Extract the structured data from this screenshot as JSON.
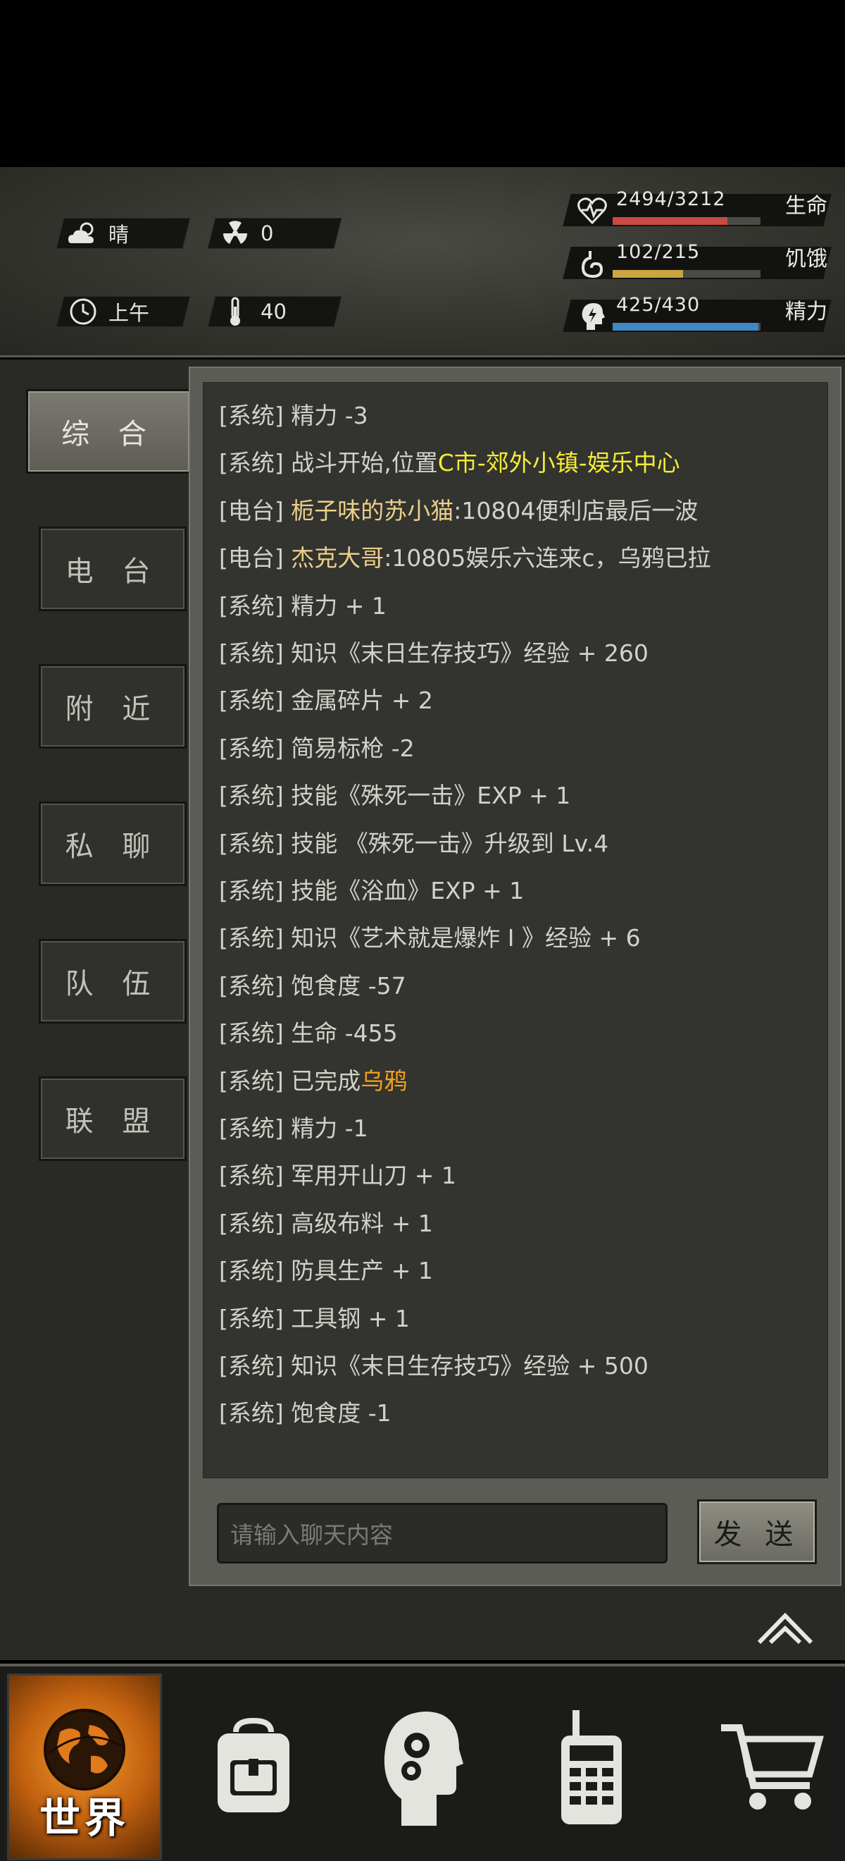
{
  "status": {
    "weather": "晴",
    "radiation": "0",
    "time_of_day": "上午",
    "temperature": "40",
    "health": {
      "value": "2494/3212",
      "label": "生命",
      "fraction": 0.776,
      "color": "#c94a45"
    },
    "hunger": {
      "value": "102/215",
      "label": "饥饿",
      "fraction": 0.474,
      "color": "#c9a640"
    },
    "energy": {
      "value": "425/430",
      "label": "精力",
      "fraction": 0.988,
      "color": "#3e88c4"
    }
  },
  "tabs": [
    "综 合",
    "电 台",
    "附 近",
    "私 聊",
    "队 伍",
    "联 盟"
  ],
  "chat": {
    "lines": [
      {
        "tag": "[系统]",
        "text": "精力 -3"
      },
      {
        "tag": "[系统]",
        "text": "战斗开始,位置",
        "hl": "C市-郊外小镇-娱乐中心"
      },
      {
        "tag": "[电台]",
        "name": "栀子味的苏小猫",
        "text": ":10804便利店最后一波"
      },
      {
        "tag": "[电台]",
        "name": "杰克大哥",
        "text": ":10805娱乐六连来c，乌鸦已拉"
      },
      {
        "tag": "[系统]",
        "text": "精力 + 1"
      },
      {
        "tag": "[系统]",
        "text": "知识《末日生存技巧》经验 + 260"
      },
      {
        "tag": "[系统]",
        "text": "金属碎片 + 2"
      },
      {
        "tag": "[系统]",
        "text": "简易标枪 -2"
      },
      {
        "tag": "[系统]",
        "text": "技能《殊死一击》EXP + 1"
      },
      {
        "tag": "[系统]",
        "text": "技能 《殊死一击》升级到 Lv.4"
      },
      {
        "tag": "[系统]",
        "text": "技能《浴血》EXP + 1"
      },
      {
        "tag": "[系统]",
        "text": "知识《艺术就是爆炸 I 》经验 + 6"
      },
      {
        "tag": "[系统]",
        "text": "饱食度 -57"
      },
      {
        "tag": "[系统]",
        "text": "生命 -455"
      },
      {
        "tag": "[系统]",
        "text": "已完成",
        "hl2": "乌鸦"
      },
      {
        "tag": "[系统]",
        "text": "精力 -1"
      },
      {
        "tag": "[系统]",
        "text": "军用开山刀 + 1"
      },
      {
        "tag": "[系统]",
        "text": "高级布料 + 1"
      },
      {
        "tag": "[系统]",
        "text": "防具生产 + 1"
      },
      {
        "tag": "[系统]",
        "text": "工具钢 + 1"
      },
      {
        "tag": "[系统]",
        "text": "知识《末日生存技巧》经验 + 500"
      },
      {
        "tag": "[系统]",
        "text": "饱食度 -1"
      }
    ],
    "input_placeholder": "请输入聊天内容",
    "send_label": "发 送"
  },
  "nav": {
    "world_label": "世界",
    "items": [
      "globe-icon",
      "backpack-icon",
      "head-gear-icon",
      "radio-icon",
      "cart-icon"
    ]
  }
}
